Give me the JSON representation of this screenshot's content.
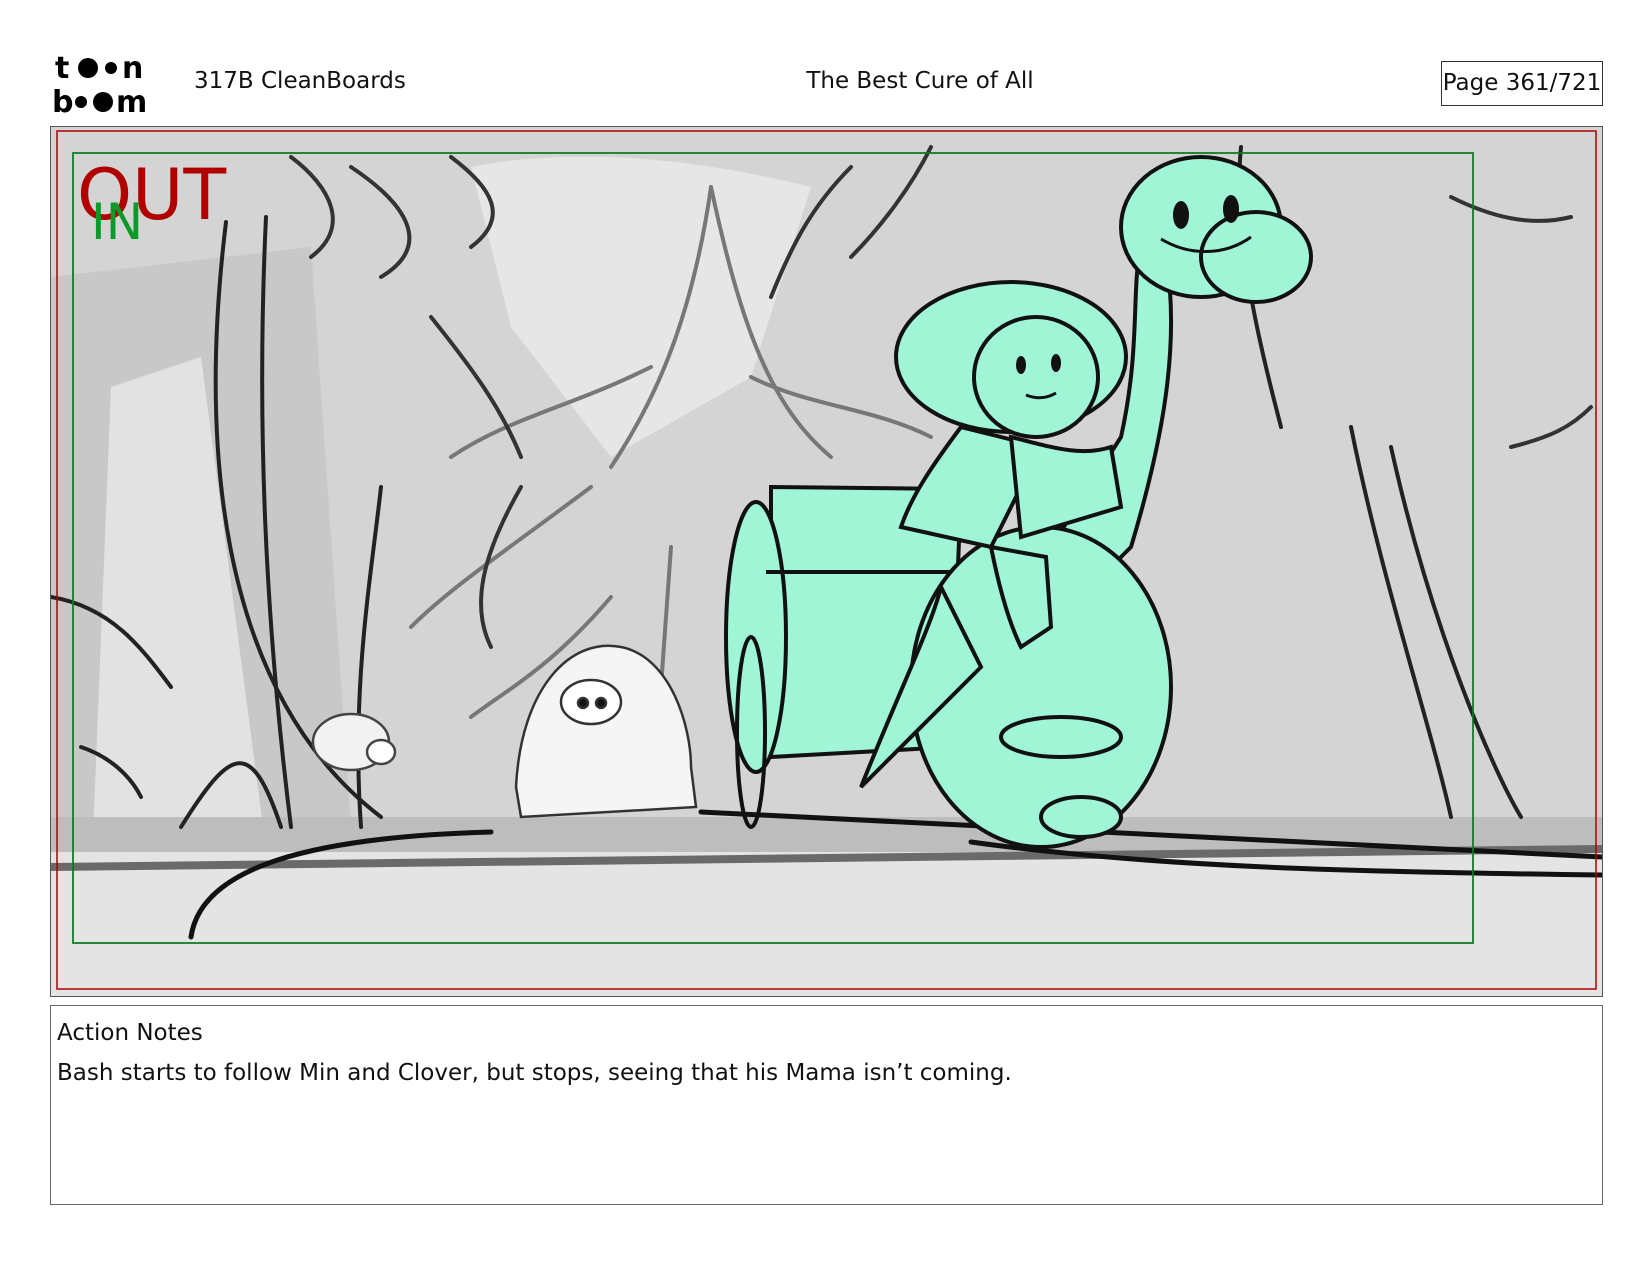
{
  "header": {
    "logo_text": [
      "to",
      "on",
      "bo",
      "om"
    ],
    "project": "317B  CleanBoards",
    "title": "The Best Cure of All",
    "page": "Page 361/721"
  },
  "panel": {
    "out_label": "OUT",
    "in_label": "IN",
    "colors": {
      "out": "#b00000",
      "in": "#0a9a2a",
      "character_fill": "#9ff5d6",
      "background": "#d6d6d6"
    }
  },
  "notes": {
    "heading": "Action Notes",
    "text": "Bash starts to follow Min and Clover, but stops, seeing that his Mama isn’t coming."
  }
}
